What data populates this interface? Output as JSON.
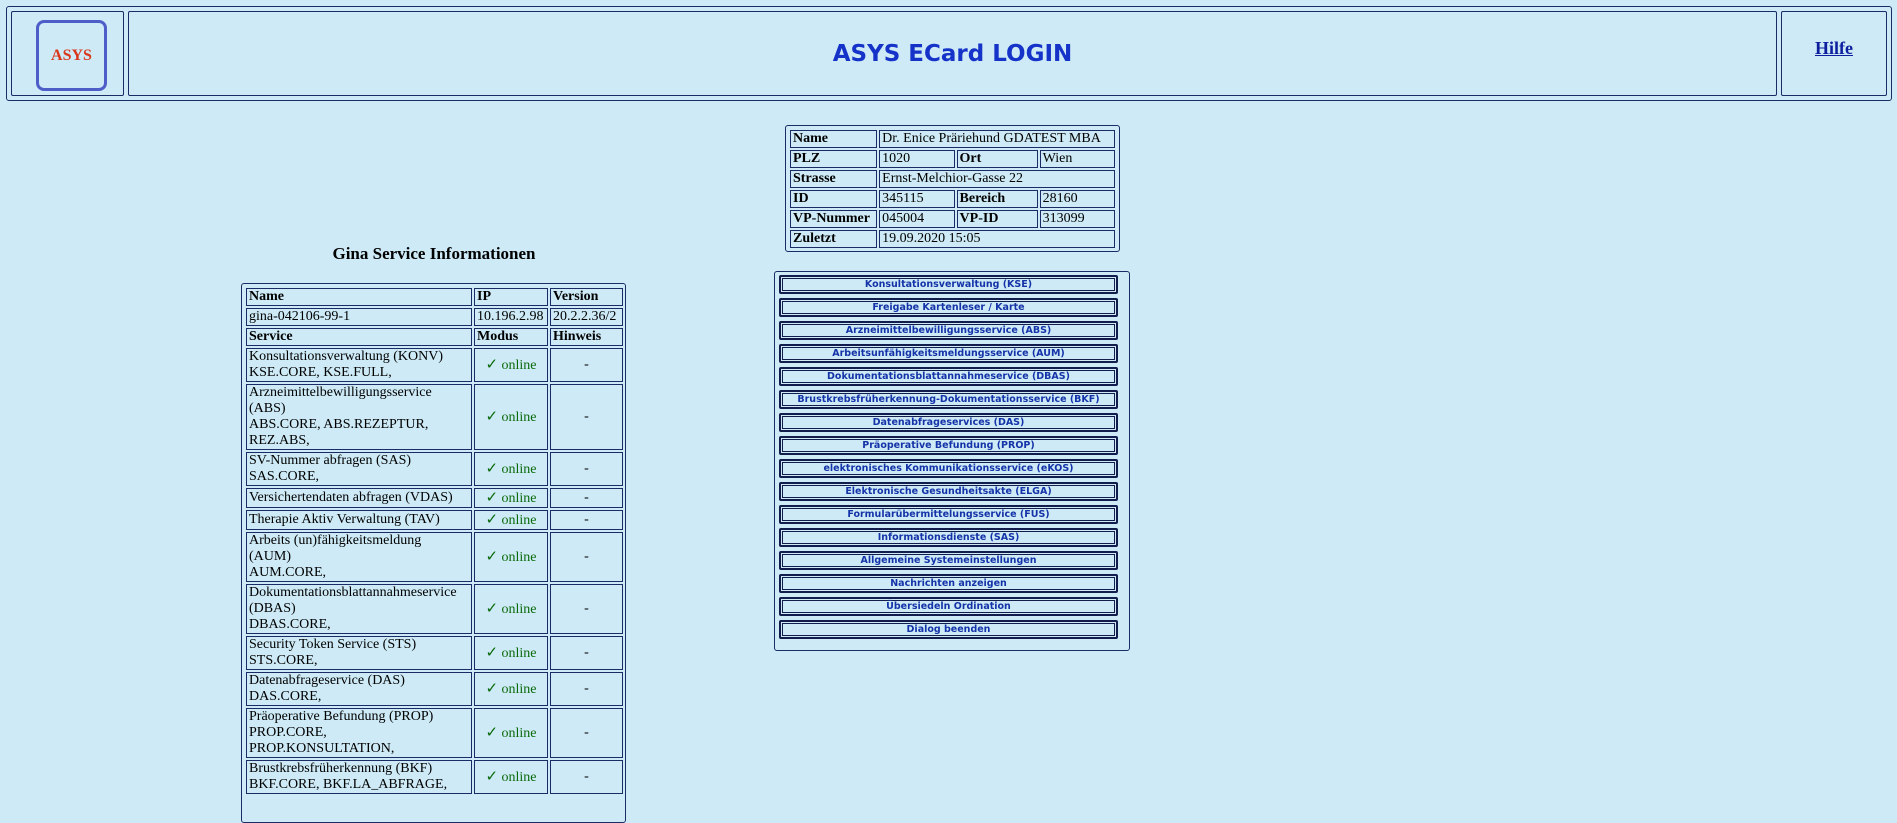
{
  "header": {
    "logo_text": "ASYS",
    "title": "ASYS ECard LOGIN",
    "help_label": "Hilfe"
  },
  "person": {
    "name_label": "Name",
    "name_value": "Dr. Enice Präriehund GDATEST MBA",
    "plz_label": "PLZ",
    "plz_value": "1020",
    "ort_label": "Ort",
    "ort_value": "Wien",
    "strasse_label": "Strasse",
    "strasse_value": "Ernst-Melchior-Gasse 22",
    "id_label": "ID",
    "id_value": "345115",
    "bereich_label": "Bereich",
    "bereich_value": "28160",
    "vp_nummer_label": "VP-Nummer",
    "vp_nummer_value": "045004",
    "vp_id_label": "VP-ID",
    "vp_id_value": "313099",
    "zuletzt_label": "Zuletzt",
    "zuletzt_value": "19.09.2020 15:05"
  },
  "gina": {
    "heading": "Gina Service Informationen",
    "col_name": "Name",
    "col_ip": "IP",
    "col_version": "Version",
    "name_value": "gina-042106-99-1",
    "ip_value": "10.196.2.98",
    "version_value": "20.2.2.36/2",
    "col_service": "Service",
    "col_modus": "Modus",
    "col_hinweis": "Hinweis",
    "services": [
      {
        "lines": [
          "Konsultationsverwaltung (KONV)",
          "KSE.CORE, KSE.FULL,"
        ],
        "modus": "online",
        "hinweis": "-"
      },
      {
        "lines": [
          "Arzneimittelbewilligungsservice",
          "(ABS)",
          "ABS.CORE, ABS.REZEPTUR,",
          "REZ.ABS,"
        ],
        "modus": "online",
        "hinweis": "-"
      },
      {
        "lines": [
          "SV-Nummer abfragen (SAS)",
          "SAS.CORE,"
        ],
        "modus": "online",
        "hinweis": "-"
      },
      {
        "lines": [
          "Versichertendaten abfragen (VDAS)"
        ],
        "modus": "online",
        "hinweis": "-"
      },
      {
        "lines": [
          "Therapie Aktiv Verwaltung (TAV)"
        ],
        "modus": "online",
        "hinweis": "-"
      },
      {
        "lines": [
          "Arbeits (un)fähigkeitsmeldung",
          "(AUM)",
          "AUM.CORE,"
        ],
        "modus": "online",
        "hinweis": "-"
      },
      {
        "lines": [
          "Dokumentationsblattannahmeservice",
          "(DBAS)",
          "DBAS.CORE,"
        ],
        "modus": "online",
        "hinweis": "-"
      },
      {
        "lines": [
          "Security Token Service (STS)",
          "STS.CORE,"
        ],
        "modus": "online",
        "hinweis": "-"
      },
      {
        "lines": [
          "Datenabfrageservice (DAS)",
          "DAS.CORE,"
        ],
        "modus": "online",
        "hinweis": "-"
      },
      {
        "lines": [
          "Präoperative Befundung (PROP)",
          "PROP.CORE,",
          "PROP.KONSULTATION,"
        ],
        "modus": "online",
        "hinweis": "-"
      },
      {
        "lines": [
          "Brustkrebsfrüherkennung (BKF)",
          "BKF.CORE, BKF.LA_ABFRAGE,"
        ],
        "modus": "online",
        "hinweis": "-"
      }
    ]
  },
  "menu": [
    "Konsultationsverwaltung (KSE)",
    "Freigabe Kartenleser / Karte",
    "Arzneimittelbewilligungsservice (ABS)",
    "Arbeitsunfähigkeitsmeldungsservice (AUM)",
    "Dokumentationsblattannahmeservice (DBAS)",
    "Brustkrebsfrüherkennung-Dokumentationsservice (BKF)",
    "Datenabfrageservices (DAS)",
    "Präoperative Befundung (PROP)",
    "elektronisches Kommunikationsservice (eKOS)",
    "Elektronische Gesundheitsakte (ELGA)",
    "Formularübermittelungsservice (FUS)",
    "Informationsdienste (SAS)",
    "Allgemeine Systemeinstellungen",
    "Nachrichten anzeigen",
    "Übersiedeln Ordination",
    "Dialog beenden"
  ],
  "colors": {
    "background": "#cdeaf6",
    "title": "#1533c8",
    "button_text": "#1533a8",
    "online": "#0a6a0a",
    "logo_text": "#d9361c"
  }
}
